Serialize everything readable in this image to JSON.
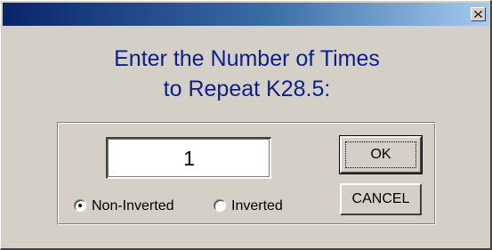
{
  "window": {
    "title": ""
  },
  "prompt": {
    "line1": "Enter the Number of Times",
    "line2": "to Repeat K28.5:"
  },
  "form": {
    "count_value": "1",
    "radio_options": [
      {
        "label": "Non-Inverted",
        "selected": true
      },
      {
        "label": "Inverted",
        "selected": false
      }
    ]
  },
  "buttons": {
    "ok_label": "OK",
    "cancel_label": "CANCEL"
  },
  "colors": {
    "prompt_text": "#0a1e8c",
    "titlebar_start": "#0a246a",
    "titlebar_end": "#a6caf0",
    "face": "#d4d0c8"
  },
  "icons": {
    "close": "close-icon"
  }
}
